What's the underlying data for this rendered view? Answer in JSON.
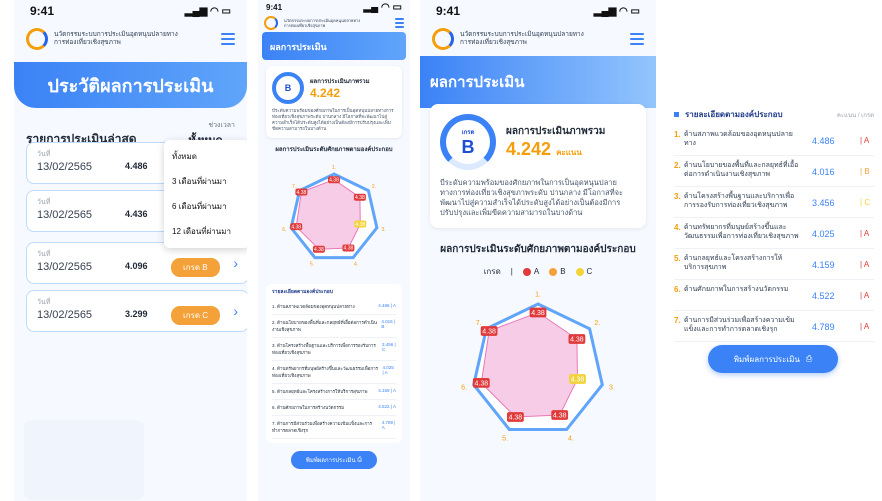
{
  "status": {
    "time": "9:41"
  },
  "app": {
    "name_line1": "นวัตกรรมระบบการประเมินอุดหนุนปลายทาง",
    "name_line2": "การท่องเที่ยวเชิงสุขภาพ"
  },
  "history": {
    "title": "ประวัติผลการประเมิน",
    "list_title": "รายการประเมินล่าสุด",
    "filter_label": "ช่วงเวลา",
    "filter_value": "ทั้งหมด",
    "date_label": "วันที่",
    "items": [
      {
        "date": "13/02/2565",
        "score": "4.486",
        "grade": ""
      },
      {
        "date": "13/02/2565",
        "score": "4.436",
        "grade": ""
      },
      {
        "date": "13/02/2565",
        "score": "4.096",
        "grade": "เกรด B"
      },
      {
        "date": "13/02/2565",
        "score": "3.299",
        "grade": "เกรด C"
      }
    ],
    "dropdown": [
      "ทั้งหมด",
      "3 เดือนที่ผ่านมา",
      "6 เดือนที่ผ่านมา",
      "12 เดือนที่ผ่านมา"
    ]
  },
  "result": {
    "title": "ผลการประเมิน",
    "overall_title": "ผลการประเมินภาพรวม",
    "grade_label": "เกรด",
    "grade": "B",
    "score": "4.242",
    "unit": "คะแนน",
    "description": "บีระดับความพร้อมของศักยภาพในการเป็นอุดหนุนปลายทางการท่องเที่ยวเชิงสุขภาพระดับ ปานกลาง มีโอกาสที่จะพัฒนาไปสู่ความสำเร็จได้ประดับสูงได้อย่างเป็นต้องมีการปรับปรุงและเพิ่มขีดความสามารถในบางด้าน",
    "chart_heading": "ผลการประเมินระดับศักยภาพตามองค์ประกอบ",
    "legend_label": "เกรด",
    "legend": [
      {
        "name": "A",
        "color": "#e03a3a"
      },
      {
        "name": "B",
        "color": "#f4a13a"
      },
      {
        "name": "C",
        "color": "#f2d33a"
      }
    ]
  },
  "chart_data": {
    "type": "radar",
    "axes": [
      "1",
      "2",
      "3",
      "4",
      "5",
      "6",
      "7"
    ],
    "values": [
      4.486,
      4.016,
      3.456,
      4.025,
      4.159,
      4.522,
      4.789
    ],
    "point_labels": [
      "4.38",
      "4.38",
      "4.38",
      "4.38",
      "4.38",
      "4.38",
      "4.38"
    ]
  },
  "details": {
    "title": "รายละเอียดตามองค์ประกอบ",
    "cols": "คะแนน / เกรด",
    "items": [
      {
        "num": "1.",
        "label": "ด้านสภาพแวดล้อมของอุดหนุนปลายทาง",
        "score": "4.486",
        "grade": "A",
        "gcolor": "#e03a3a"
      },
      {
        "num": "2.",
        "label": "ด้านนโยบายของพื้นที่และกลยุทธ์ที่เอื้อต่อการดำเนินงานเชิงสุขภาพ",
        "score": "4.016",
        "grade": "B",
        "gcolor": "#f4a13a"
      },
      {
        "num": "3.",
        "label": "ด้านโครงสร้างพื้นฐานและบริการเพื่อการรองรับการท่องเที่ยวเชิงสุขภาพ",
        "score": "3.456",
        "grade": "C",
        "gcolor": "#f2d33a"
      },
      {
        "num": "4.",
        "label": "ด้านทรัพยากรที่มนุษย์สร้างขึ้นและวัฒนธรรมเพื่อการท่องเที่ยวเชิงสุขภาพ",
        "score": "4.025",
        "grade": "A",
        "gcolor": "#e03a3a"
      },
      {
        "num": "5.",
        "label": "ด้านกลยุทธ์และโครงสร้างการให้บริการสุขภาพ",
        "score": "4.159",
        "grade": "A",
        "gcolor": "#e03a3a"
      },
      {
        "num": "6.",
        "label": "ด้านศักยภาพในการสร้างนวัตกรรม",
        "score": "4.522",
        "grade": "A",
        "gcolor": "#e03a3a"
      },
      {
        "num": "7.",
        "label": "ด้านการมีส่วนร่วมเพื่อสร้างความเข้มแข็งและการทำการตลาดเชิงรุก",
        "score": "4.789",
        "grade": "A",
        "gcolor": "#e03a3a"
      }
    ],
    "print_button": "พิมพ์ผลการประเมิน"
  }
}
